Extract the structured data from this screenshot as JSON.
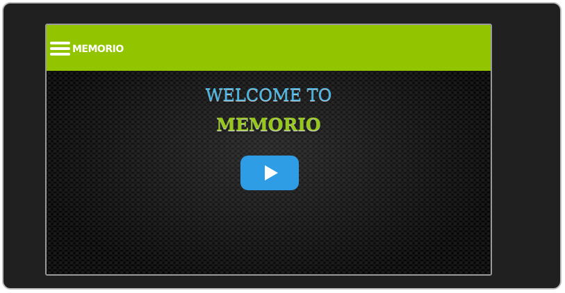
{
  "header": {
    "brand": "MEMORIO",
    "menu_icon": "hamburger-menu-icon",
    "background_color": "#93c400"
  },
  "hero": {
    "welcome_text": "WELCOME TO",
    "title_text": "MEMORIO",
    "welcome_color": "#3fb6e8",
    "title_color": "#96c81a",
    "play_icon": "play-icon",
    "play_button_color": "#2e9de6"
  }
}
